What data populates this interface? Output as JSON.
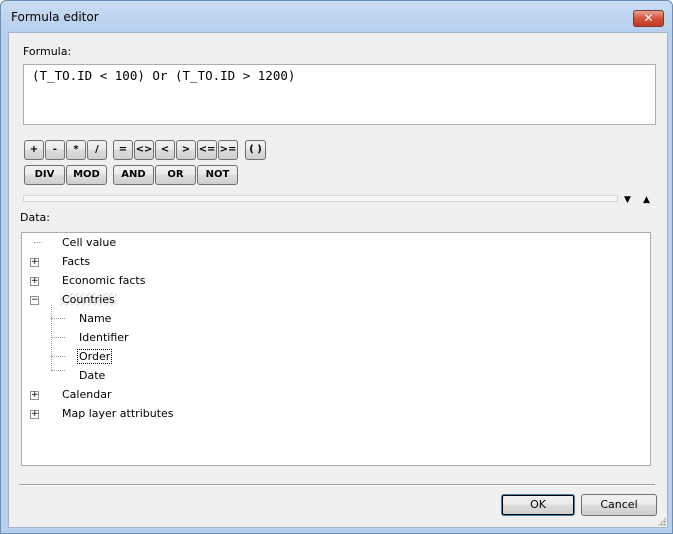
{
  "window": {
    "title": "Formula editor",
    "close_icon": "close-icon"
  },
  "formula": {
    "label": "Formula:",
    "value": "(T_TO.ID < 100) Or (T_TO.ID > 1200)"
  },
  "operators_row1": [
    "+",
    "-",
    "*",
    "/",
    "=",
    "<>",
    "<",
    ">",
    "<=",
    ">=",
    "( )"
  ],
  "operators_row2": [
    "DIV",
    "MOD",
    "AND",
    "OR",
    "NOT"
  ],
  "data": {
    "label": "Data:",
    "tree": [
      {
        "label": "Cell value",
        "expander": "none"
      },
      {
        "label": "Facts",
        "expander": "plus"
      },
      {
        "label": "Economic facts",
        "expander": "plus"
      },
      {
        "label": "Countries",
        "expander": "minus",
        "children": [
          "Name",
          "Identifier",
          "Order",
          "Date"
        ],
        "selected_child": "Order"
      },
      {
        "label": "Calendar",
        "expander": "plus"
      },
      {
        "label": "Map layer attributes",
        "expander": "plus"
      }
    ]
  },
  "buttons": {
    "ok": "OK",
    "cancel": "Cancel"
  }
}
